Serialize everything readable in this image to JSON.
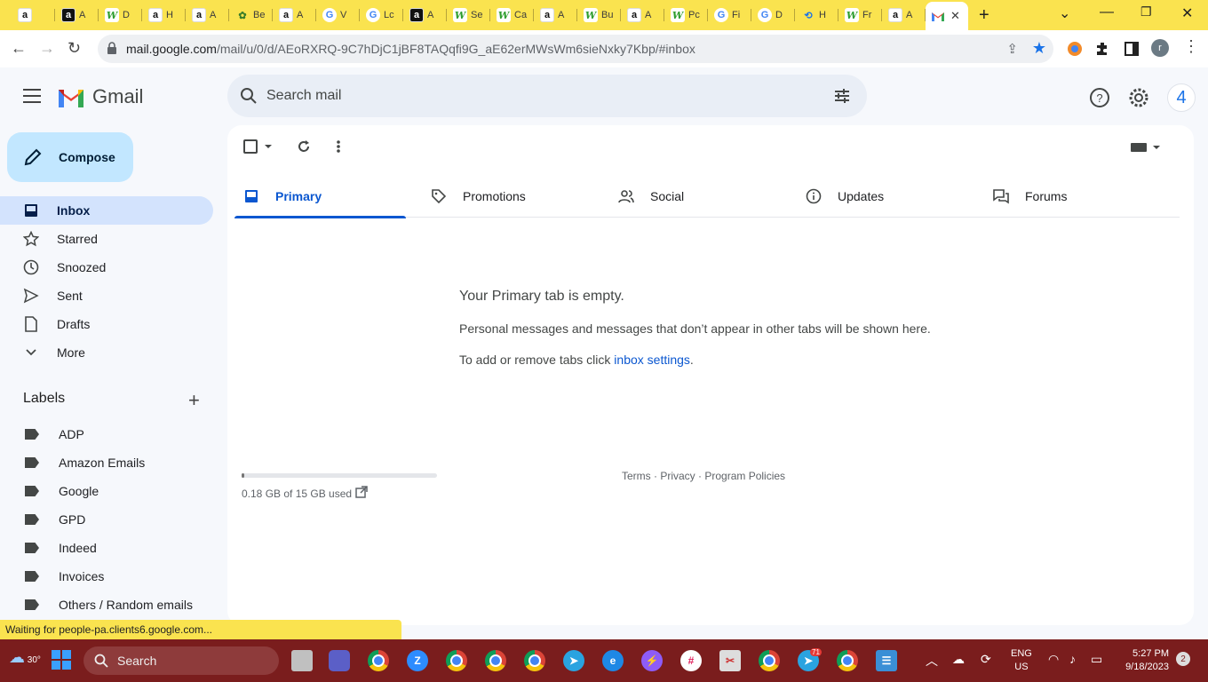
{
  "browser": {
    "tabs": [
      {
        "icon": "amazon-icon",
        "label": ""
      },
      {
        "icon": "amazon-icon",
        "label": "A"
      },
      {
        "icon": "w-icon",
        "label": "D"
      },
      {
        "icon": "amazon-icon",
        "label": "H"
      },
      {
        "icon": "amazon-icon",
        "label": "A"
      },
      {
        "icon": "leaf-icon",
        "label": "Be"
      },
      {
        "icon": "amazon-icon",
        "label": "A"
      },
      {
        "icon": "google-icon",
        "label": "V"
      },
      {
        "icon": "google-icon",
        "label": "Lc"
      },
      {
        "icon": "amazon-icon",
        "label": "A"
      },
      {
        "icon": "w-icon",
        "label": "Se"
      },
      {
        "icon": "w-icon",
        "label": "Ca"
      },
      {
        "icon": "amazon-icon",
        "label": "A"
      },
      {
        "icon": "w-icon",
        "label": "Bu"
      },
      {
        "icon": "amazon-icon",
        "label": "A"
      },
      {
        "icon": "w-icon",
        "label": "Pc"
      },
      {
        "icon": "google-icon",
        "label": "Fi"
      },
      {
        "icon": "google-icon",
        "label": "D"
      },
      {
        "icon": "history-icon",
        "label": "H"
      },
      {
        "icon": "w-icon",
        "label": "Fr"
      },
      {
        "icon": "amazon-icon",
        "label": "A"
      }
    ],
    "url_host": "mail.google.com",
    "url_path": "/mail/u/0/d/AEoRXRQ-9C7hDjC1jBF8TAQqfi9G_aE62erMWsWm6sieNxky7Kbp/#inbox",
    "profile_initial": "r",
    "status_text": "Waiting for people-pa.clients6.google.com..."
  },
  "gmail": {
    "logo_text": "Gmail",
    "search_placeholder": "Search mail",
    "account_initial": "4",
    "compose_label": "Compose",
    "nav": [
      {
        "label": "Inbox",
        "icon": "inbox-icon",
        "active": true
      },
      {
        "label": "Starred",
        "icon": "star-icon"
      },
      {
        "label": "Snoozed",
        "icon": "clock-icon"
      },
      {
        "label": "Sent",
        "icon": "send-icon"
      },
      {
        "label": "Drafts",
        "icon": "draft-icon"
      },
      {
        "label": "More",
        "icon": "chevron-down-icon"
      }
    ],
    "labels_title": "Labels",
    "labels": [
      "ADP",
      "Amazon Emails",
      "Google",
      "GPD",
      "Indeed",
      "Invoices",
      "Others / Random emails"
    ],
    "tabs": [
      "Primary",
      "Promotions",
      "Social",
      "Updates",
      "Forums"
    ],
    "empty": {
      "title": "Your Primary tab is empty.",
      "desc": "Personal messages and messages that don’t appear in other tabs will be shown here.",
      "hint_prefix": "To add or remove tabs click ",
      "hint_link": "inbox settings",
      "hint_suffix": "."
    },
    "storage": {
      "text": "0.18 GB of 15 GB used",
      "used_fraction": 0.012
    },
    "footer": {
      "terms": "Terms",
      "privacy": "Privacy",
      "policies": "Program Policies",
      "sep": " · "
    }
  },
  "taskbar": {
    "weather": "30°",
    "search_label": "Search",
    "lang_top": "ENG",
    "lang_bottom": "US",
    "time": "5:27 PM",
    "date": "9/18/2023",
    "notifications": "2",
    "telegram_badge": "71"
  }
}
